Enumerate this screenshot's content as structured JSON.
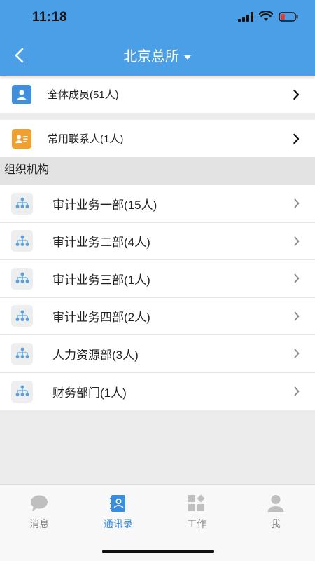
{
  "status_bar": {
    "time": "11:18"
  },
  "nav": {
    "title": "北京总所"
  },
  "top_rows": [
    {
      "label": "全体成员(51人)",
      "icon": "person-card-icon",
      "color": "#3f8fdd"
    },
    {
      "label": "常用联系人(1人)",
      "icon": "contact-card-icon",
      "color": "#f0a030"
    }
  ],
  "section": {
    "title": "组织机构"
  },
  "departments": [
    {
      "label": "审计业务一部(15人)"
    },
    {
      "label": "审计业务二部(4人)"
    },
    {
      "label": "审计业务三部(1人)"
    },
    {
      "label": "审计业务四部(2人)"
    },
    {
      "label": "人力资源部(3人)"
    },
    {
      "label": "财务部门(1人)"
    }
  ],
  "tabbar": {
    "tabs": [
      {
        "label": "消息",
        "icon": "chat-bubble-icon",
        "active": false
      },
      {
        "label": "通讯录",
        "icon": "address-book-icon",
        "active": true
      },
      {
        "label": "工作",
        "icon": "apps-grid-icon",
        "active": false
      },
      {
        "label": "我",
        "icon": "user-profile-icon",
        "active": false
      }
    ]
  },
  "colors": {
    "primary": "#4a9fe6",
    "active_tab": "#3a8ee0",
    "inactive_tab": "#888888"
  }
}
